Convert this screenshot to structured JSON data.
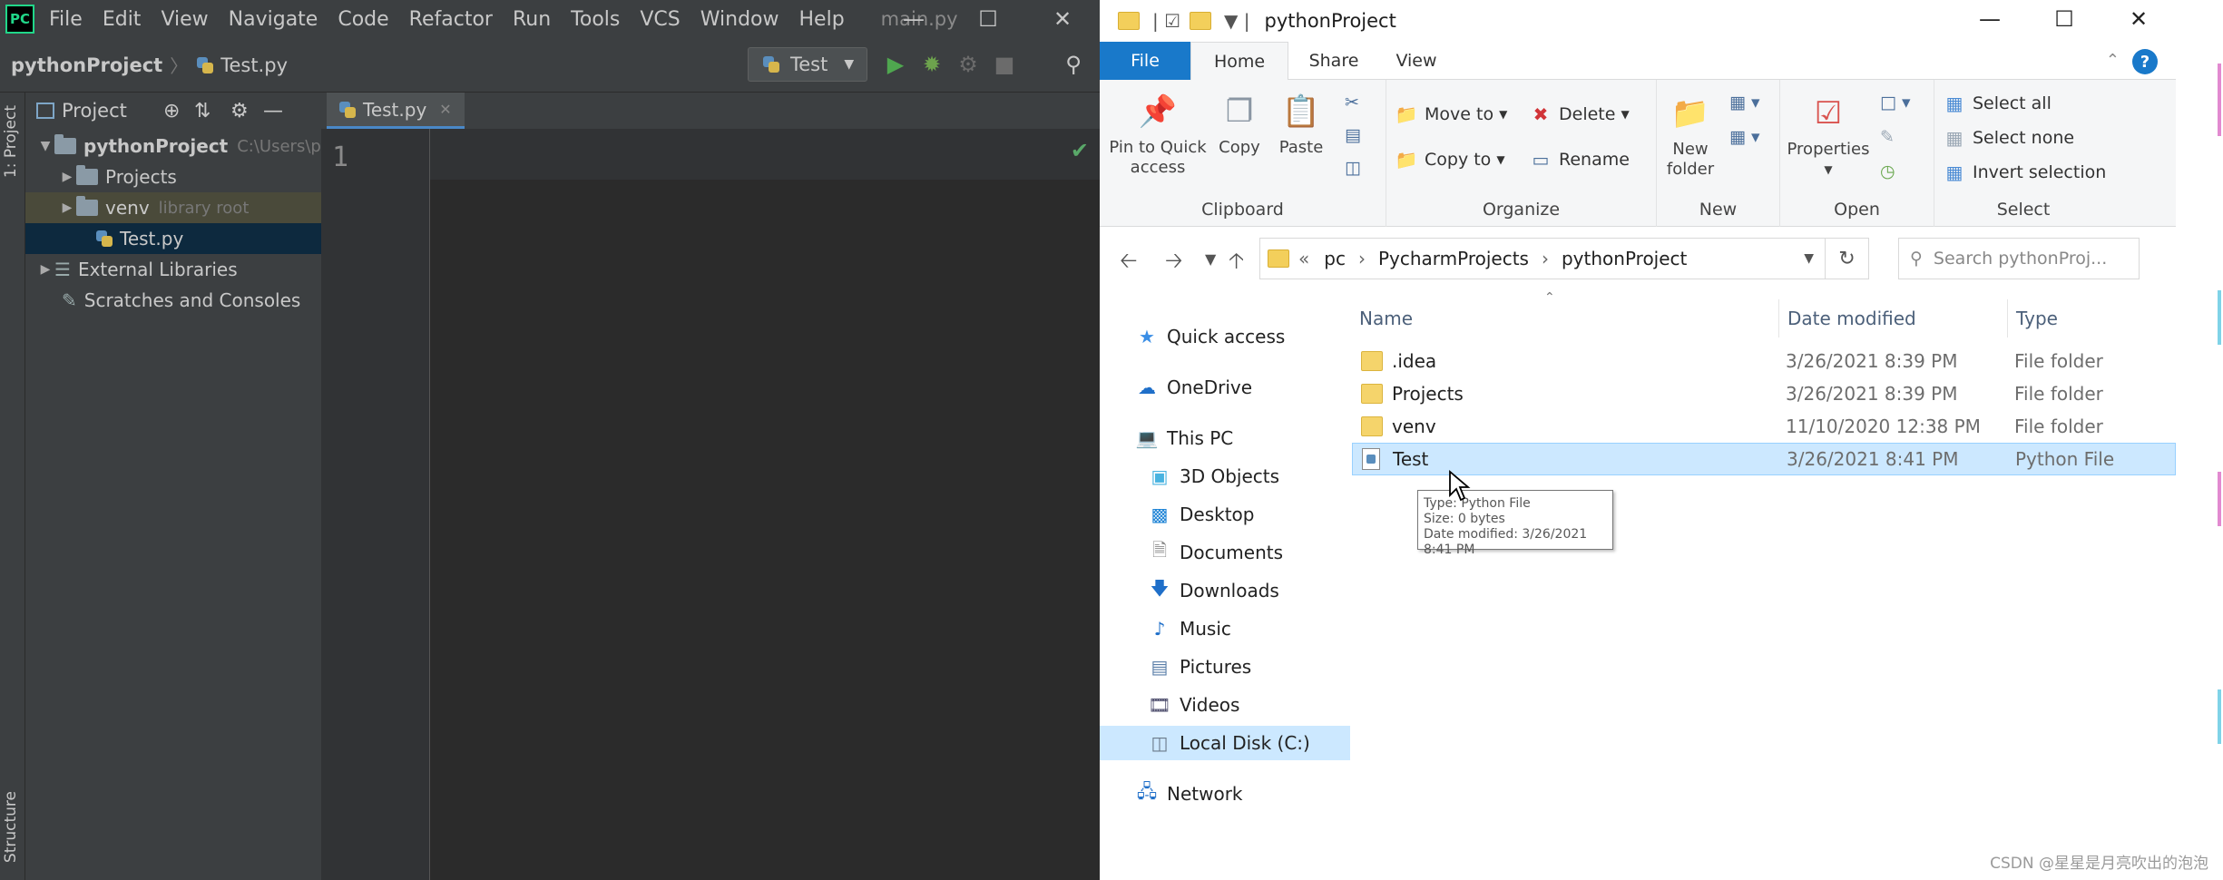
{
  "ide": {
    "logo": "PC",
    "menu": [
      "File",
      "Edit",
      "View",
      "Navigate",
      "Code",
      "Refactor",
      "Run",
      "Tools",
      "VCS",
      "Window",
      "Help"
    ],
    "open_file_title": "main.py",
    "breadcrumb": {
      "project": "pythonProject",
      "file": "Test.py"
    },
    "run_config": "Test",
    "left_tabs": {
      "project": "1: Project",
      "structure": "Structure"
    },
    "project_panel": {
      "header": "Project",
      "tree": [
        {
          "label": "pythonProject",
          "hint": "C:\\Users\\p"
        },
        {
          "label": "Projects"
        },
        {
          "label": "venv",
          "hint": "library root"
        },
        {
          "label": "Test.py"
        },
        {
          "label": "External Libraries"
        },
        {
          "label": "Scratches and Consoles"
        }
      ]
    },
    "editor": {
      "tab": "Test.py",
      "line_number": "1"
    },
    "colors": {
      "background": "#2b2b2b",
      "panel": "#3c3f41",
      "selection": "#0d293e",
      "accent": "#4a88c7"
    }
  },
  "explorer": {
    "title": "pythonProject",
    "ribbon_tabs": [
      "File",
      "Home",
      "Share",
      "View"
    ],
    "groups": {
      "clipboard": {
        "label": "Clipboard",
        "pin": "Pin to Quick access",
        "copy": "Copy",
        "paste": "Paste"
      },
      "organize": {
        "label": "Organize",
        "move_to": "Move to",
        "copy_to": "Copy to",
        "delete": "Delete",
        "rename": "Rename"
      },
      "new": {
        "label": "New",
        "new_folder": "New folder"
      },
      "open": {
        "label": "Open",
        "properties": "Properties"
      },
      "select": {
        "label": "Select",
        "select_all": "Select all",
        "select_none": "Select none",
        "invert": "Invert selection"
      }
    },
    "address": {
      "prefix": "«",
      "parts": [
        "pc",
        "PycharmProjects",
        "pythonProject"
      ]
    },
    "search_placeholder": "Search pythonProj...",
    "nav": [
      "Quick access",
      "OneDrive",
      "This PC",
      "3D Objects",
      "Desktop",
      "Documents",
      "Downloads",
      "Music",
      "Pictures",
      "Videos",
      "Local Disk (C:)",
      "Network"
    ],
    "columns": [
      "Name",
      "Date modified",
      "Type"
    ],
    "files": [
      {
        "name": ".idea",
        "date": "3/26/2021 8:39 PM",
        "type": "File folder"
      },
      {
        "name": "Projects",
        "date": "3/26/2021 8:39 PM",
        "type": "File folder"
      },
      {
        "name": "venv",
        "date": "11/10/2020 12:38 PM",
        "type": "File folder"
      },
      {
        "name": "Test",
        "date": "3/26/2021 8:41 PM",
        "type": "Python File"
      }
    ],
    "tooltip": {
      "type": "Type: Python File",
      "size": "Size: 0 bytes",
      "date": "Date modified: 3/26/2021 8:41 PM"
    },
    "colors": {
      "file_tab": "#1979ca",
      "selection": "#cce8ff"
    }
  },
  "watermark": "CSDN @星星是月亮吹出的泡泡"
}
